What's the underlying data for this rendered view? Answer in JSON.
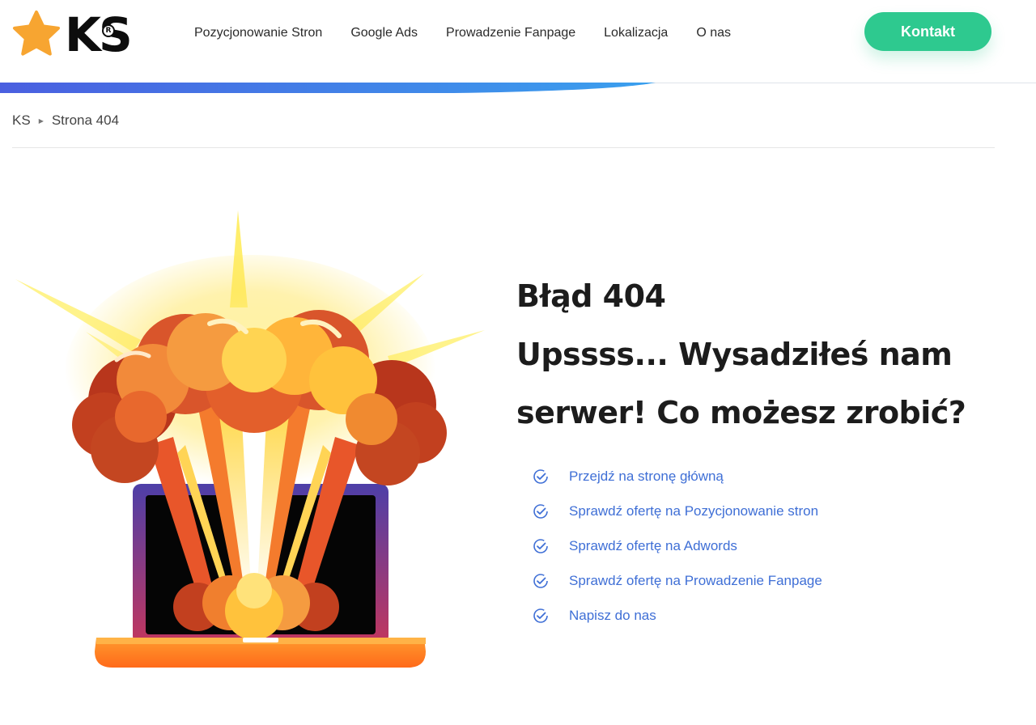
{
  "header": {
    "logo_text": "KS",
    "logo_reg": "R",
    "nav": [
      {
        "label": "Pozycjonowanie Stron"
      },
      {
        "label": "Google Ads"
      },
      {
        "label": "Prowadzenie Fanpage"
      },
      {
        "label": "Lokalizacja"
      },
      {
        "label": "O nas"
      }
    ],
    "cta_label": "Kontakt"
  },
  "breadcrumb": {
    "home": "KS",
    "current": "Strona 404"
  },
  "main": {
    "title_line1": "Błąd 404",
    "title_line2": "Upssss... Wysadziłeś nam",
    "title_line3": "serwer! Co możesz zrobić?",
    "links": [
      {
        "label": "Przejdź na stronę główną"
      },
      {
        "label": "Sprawdź ofertę na Pozycjonowanie stron"
      },
      {
        "label": "Sprawdź ofertę na Adwords"
      },
      {
        "label": "Sprawdź ofertę na Prowadzenie Fanpage"
      },
      {
        "label": "Napisz do nas"
      }
    ]
  },
  "colors": {
    "accent_green": "#2ec98f",
    "link_blue": "#3f6fd6",
    "logo_star": "#f7a531",
    "bar_gradient_start": "#4a5fe0",
    "bar_gradient_end": "#3aa0ee"
  },
  "icons": {
    "logo": "star-icon",
    "link_bullet": "check-circle-icon",
    "breadcrumb_separator": "triangle-right-icon",
    "illustration": "exploding-laptop"
  }
}
